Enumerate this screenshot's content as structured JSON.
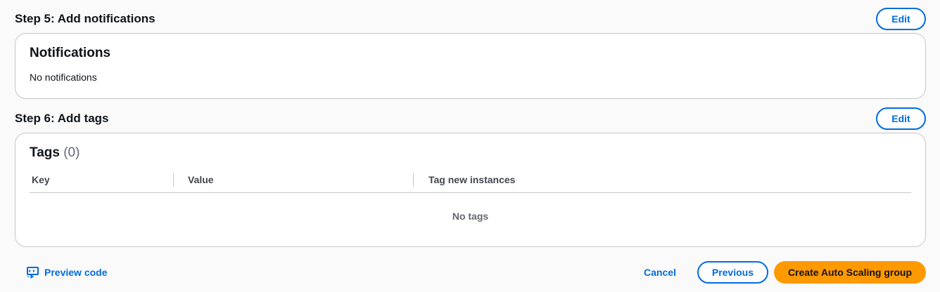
{
  "step5": {
    "title": "Step 5: Add notifications",
    "edit_label": "Edit",
    "panel": {
      "title": "Notifications",
      "text": "No notifications"
    }
  },
  "step6": {
    "title": "Step 6: Add tags",
    "edit_label": "Edit",
    "panel": {
      "title": "Tags",
      "count": "(0)",
      "columns": [
        "Key",
        "Value",
        "Tag new instances"
      ],
      "empty": "No tags"
    }
  },
  "footer": {
    "preview_code": "Preview code",
    "preview_icon": "code-preview-icon",
    "cancel": "Cancel",
    "previous": "Previous",
    "create": "Create Auto Scaling group"
  },
  "colors": {
    "link": "#006ce0",
    "primary": "#ff9900",
    "border": "#c6c6cd"
  }
}
